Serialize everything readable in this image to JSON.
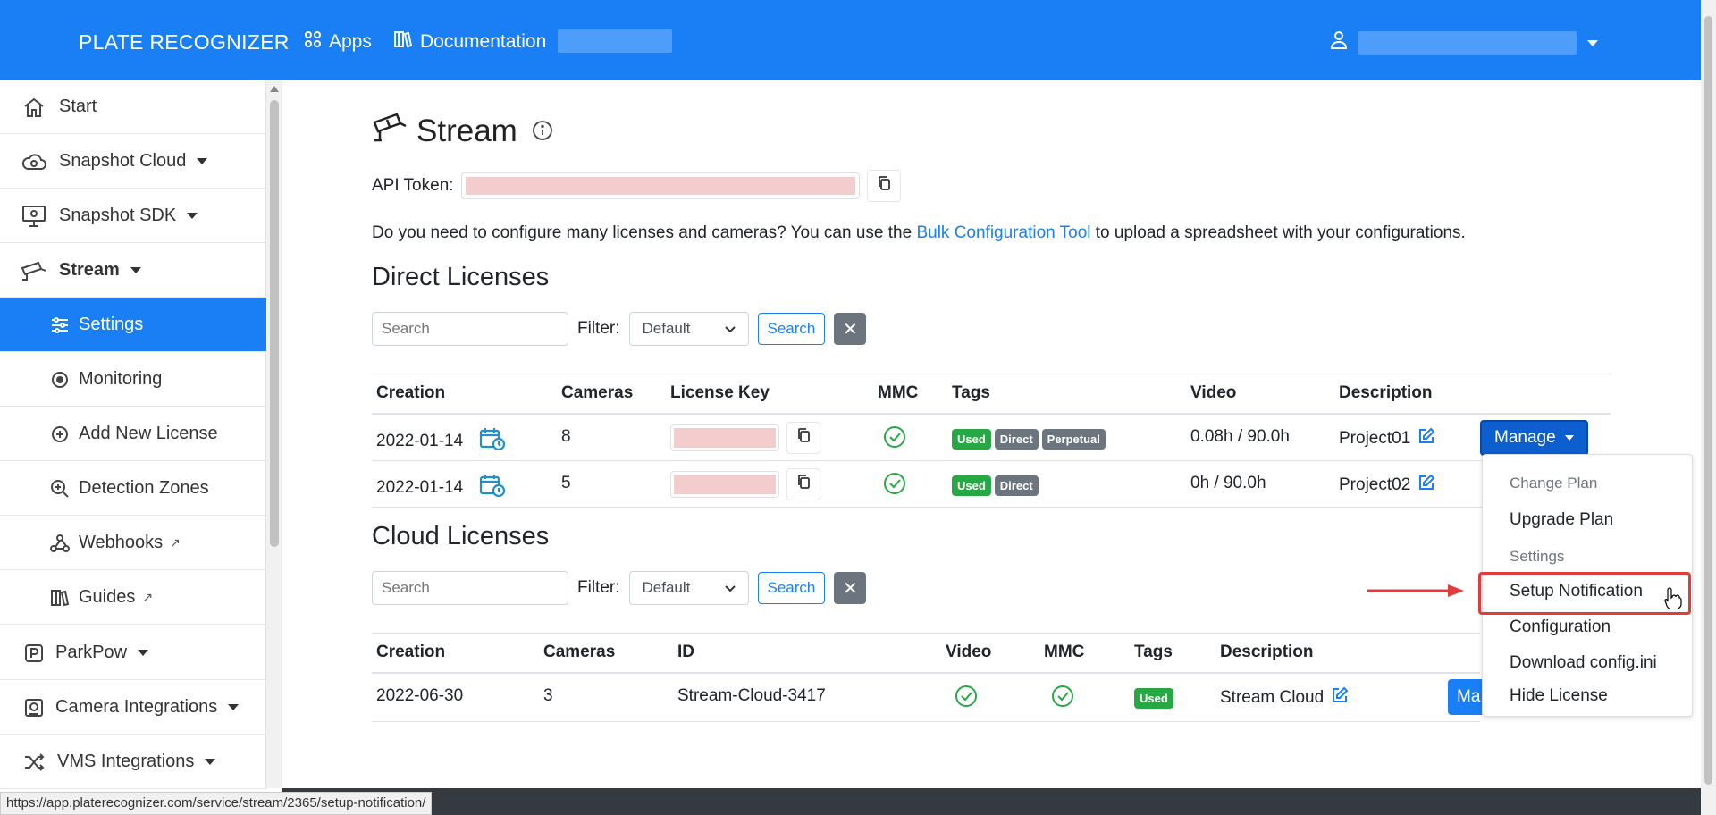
{
  "navbar": {
    "brand": "PLATE RECOGNIZER",
    "apps_label": "Apps",
    "docs_label": "Documentation",
    "color": "#1a7ef5"
  },
  "sidebar": {
    "items": [
      {
        "label": "Start",
        "icon": "home-icon"
      },
      {
        "label": "Snapshot Cloud",
        "icon": "cloud-icon"
      },
      {
        "label": "Snapshot SDK",
        "icon": "monitor-icon"
      },
      {
        "label": "Stream",
        "icon": "camera-icon"
      },
      {
        "label": "Settings",
        "icon": "sliders-icon"
      },
      {
        "label": "Monitoring",
        "icon": "record-icon"
      },
      {
        "label": "Add New License",
        "icon": "plus-circle-icon"
      },
      {
        "label": "Detection Zones",
        "icon": "zoom-icon"
      },
      {
        "label": "Webhooks",
        "icon": "webhook-icon"
      },
      {
        "label": "Guides",
        "icon": "books-icon"
      },
      {
        "label": "ParkPow",
        "icon": "parking-icon"
      },
      {
        "label": "Camera Integrations",
        "icon": "camera-box-icon"
      },
      {
        "label": "VMS Integrations",
        "icon": "shuffle-icon"
      }
    ]
  },
  "page": {
    "title": "Stream",
    "api_token_label": "API Token:",
    "desc_before": "Do you need to configure many licenses and cameras? You can use the ",
    "desc_link": "Bulk Configuration Tool",
    "desc_after": " to upload a spreadsheet with your configurations."
  },
  "direct": {
    "heading": "Direct Licenses",
    "search_placeholder": "Search",
    "filter_label": "Filter:",
    "filter_value": "Default",
    "search_button": "Search",
    "headers": [
      "Creation",
      "Cameras",
      "License Key",
      "MMC",
      "Tags",
      "Video",
      "Description"
    ],
    "rows": [
      {
        "creation": "2022-01-14",
        "cameras": "8",
        "tags": [
          "Used",
          "Direct",
          "Perpetual"
        ],
        "video": "0.08h / 90.0h",
        "description": "Project01"
      },
      {
        "creation": "2022-01-14",
        "cameras": "5",
        "tags": [
          "Used",
          "Direct"
        ],
        "video": "0h / 90.0h",
        "description": "Project02"
      }
    ],
    "manage_label": "Manage"
  },
  "cloud": {
    "heading": "Cloud Licenses",
    "search_placeholder": "Search",
    "filter_label": "Filter:",
    "filter_value": "Default",
    "search_button": "Search",
    "headers": [
      "Creation",
      "Cameras",
      "ID",
      "Video",
      "MMC",
      "Tags",
      "Description"
    ],
    "rows": [
      {
        "creation": "2022-06-30",
        "cameras": "3",
        "id": "Stream-Cloud-3417",
        "tags": [
          "Used"
        ],
        "description": "Stream Cloud"
      }
    ],
    "manage_partial": "Ma"
  },
  "dropdown": {
    "header_plan": "Change Plan",
    "upgrade": "Upgrade Plan",
    "header_settings": "Settings",
    "setup_notification": "Setup Notification",
    "configuration": "Configuration",
    "download": "Download config.ini",
    "hide": "Hide License"
  },
  "status_url": "https://app.platerecognizer.com/service/stream/2365/setup-notification/"
}
